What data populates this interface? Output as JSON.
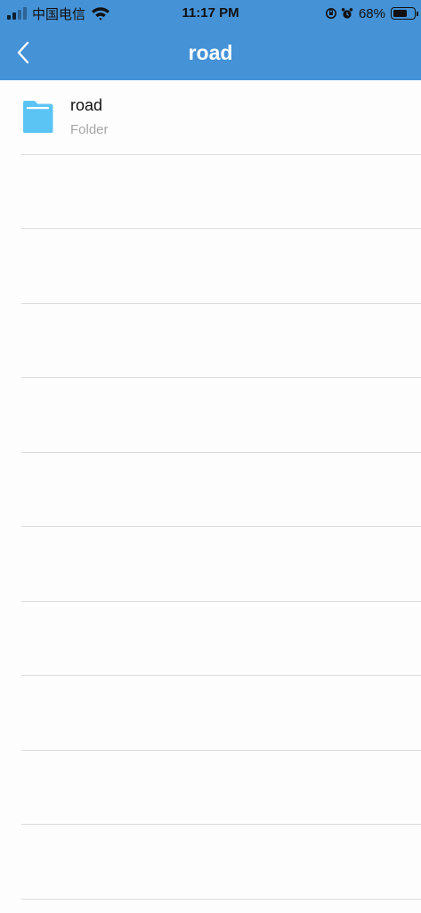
{
  "status_bar": {
    "carrier": "中国电信",
    "time": "11:17 PM",
    "battery_percent": "68%",
    "battery_level": 0.68
  },
  "nav": {
    "title": "road",
    "back_icon": "chevron-left-icon"
  },
  "files": [
    {
      "name": "road",
      "type": "Folder",
      "icon": "folder-icon",
      "icon_color": "#5cc4f5"
    }
  ],
  "colors": {
    "header": "#4592d6",
    "background": "#fdfdfd",
    "divider": "#dcdcdc"
  }
}
